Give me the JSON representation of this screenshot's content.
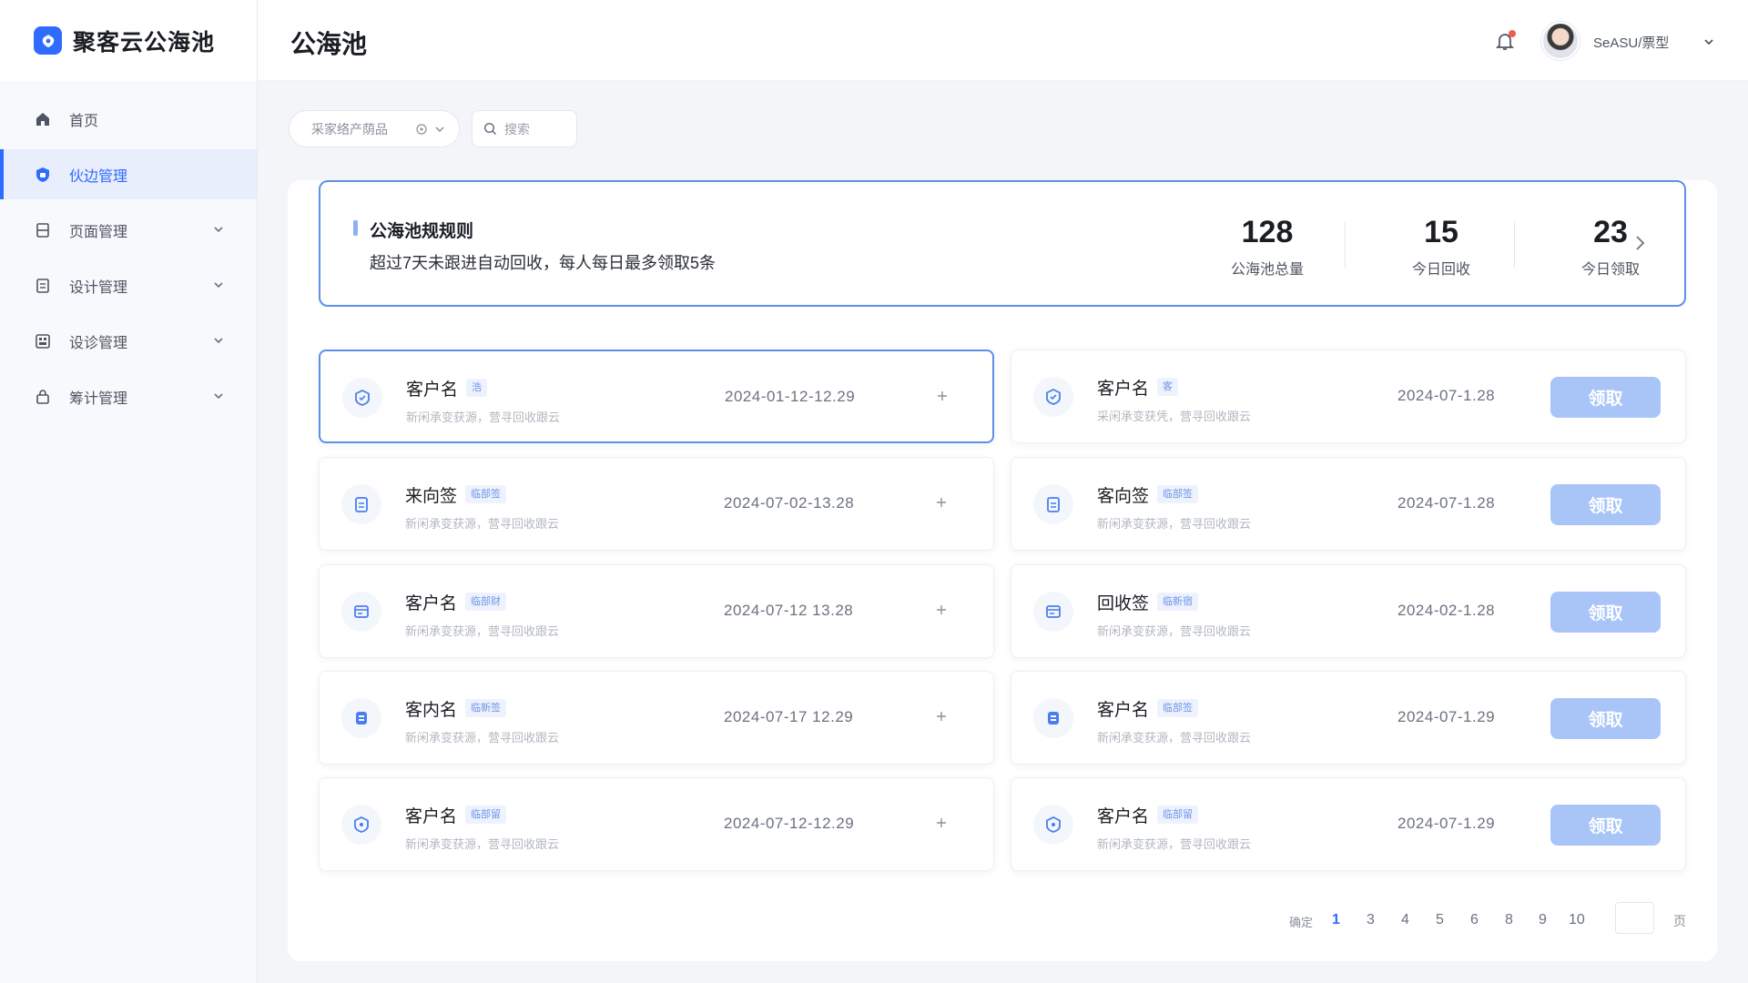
{
  "app": {
    "name": "聚客云公海池"
  },
  "sidebar": {
    "items": [
      {
        "label": "首页",
        "icon": "home-icon"
      },
      {
        "label": "伙边管理",
        "icon": "shield-icon",
        "active": true
      },
      {
        "label": "页面管理",
        "icon": "layout-icon"
      },
      {
        "label": "设计管理",
        "icon": "document-icon"
      },
      {
        "label": "设诊管理",
        "icon": "grid-icon"
      },
      {
        "label": "筹计管理",
        "icon": "lock-icon"
      }
    ]
  },
  "header": {
    "title": "公海池",
    "username": "SeASU/票型"
  },
  "filters": {
    "select_label": "采家络产荫品",
    "search_label": "搜尋",
    "search_placeholder": "搜索"
  },
  "rules": {
    "title": "公海池规规则",
    "description": "超过7天未跟进自动回收，每人每日最多领取5条",
    "stats": [
      {
        "value": "128",
        "label": "公海池总量"
      },
      {
        "value": "15",
        "label": "今日回收"
      },
      {
        "value": "23",
        "label": "今日领取"
      }
    ]
  },
  "customers_left": [
    {
      "name": "客户名",
      "tag": "浩",
      "sub": "新闲承变获源，营寻回收跟云",
      "date": "2024-01-12-12.29",
      "icon": "shield-icon"
    },
    {
      "name": "来向签",
      "tag": "临部签",
      "sub": "新闲承变获源，营寻回收跟云",
      "date": "2024-07-02-13.28",
      "icon": "file-icon"
    },
    {
      "name": "客户名",
      "tag": "临部财",
      "sub": "新闲承变获源，营寻回收跟云",
      "date": "2024-07-12 13.28",
      "icon": "card-icon"
    },
    {
      "name": "客内名",
      "tag": "临新签",
      "sub": "新闲承变获源，营寻回收跟云",
      "date": "2024-07-17 12.29",
      "icon": "badge-icon"
    },
    {
      "name": "客户名",
      "tag": "临部留",
      "sub": "新闲承变获源，营寻回收跟云",
      "date": "2024-07-12-12.29",
      "icon": "shield-icon"
    }
  ],
  "customers_right": [
    {
      "name": "客户名",
      "tag": "客",
      "sub": "采闲承变获凭，营寻回收跟云",
      "date": "2024-07-1.28",
      "icon": "shield-icon"
    },
    {
      "name": "客向签",
      "tag": "临部签",
      "sub": "新闲承变获源，营寻回收跟云",
      "date": "2024-07-1.28",
      "icon": "file-icon"
    },
    {
      "name": "回收签",
      "tag": "临新宿",
      "sub": "新闲承变获源，营寻回收跟云",
      "date": "2024-02-1.28",
      "icon": "card-icon"
    },
    {
      "name": "客户名",
      "tag": "临部签",
      "sub": "新闲承变获源，营寻回收跟云",
      "date": "2024-07-1.29",
      "icon": "badge-icon"
    },
    {
      "name": "客户名",
      "tag": "临部留",
      "sub": "新闲承变获源，营寻回收跟云",
      "date": "2024-07-1.29",
      "icon": "shield-icon"
    }
  ],
  "claim_label": "领取",
  "pagination": {
    "total_label": "确定",
    "pages": [
      "1",
      "3",
      "4",
      "5",
      "6",
      "8",
      "9",
      "10"
    ],
    "current": "1",
    "unit": "页"
  },
  "colors": {
    "accent": "#2f6bff",
    "button_disabled": "#a9c5f8",
    "tag_bg": "#edf2fd",
    "selected_border": "#5f8fe8"
  }
}
